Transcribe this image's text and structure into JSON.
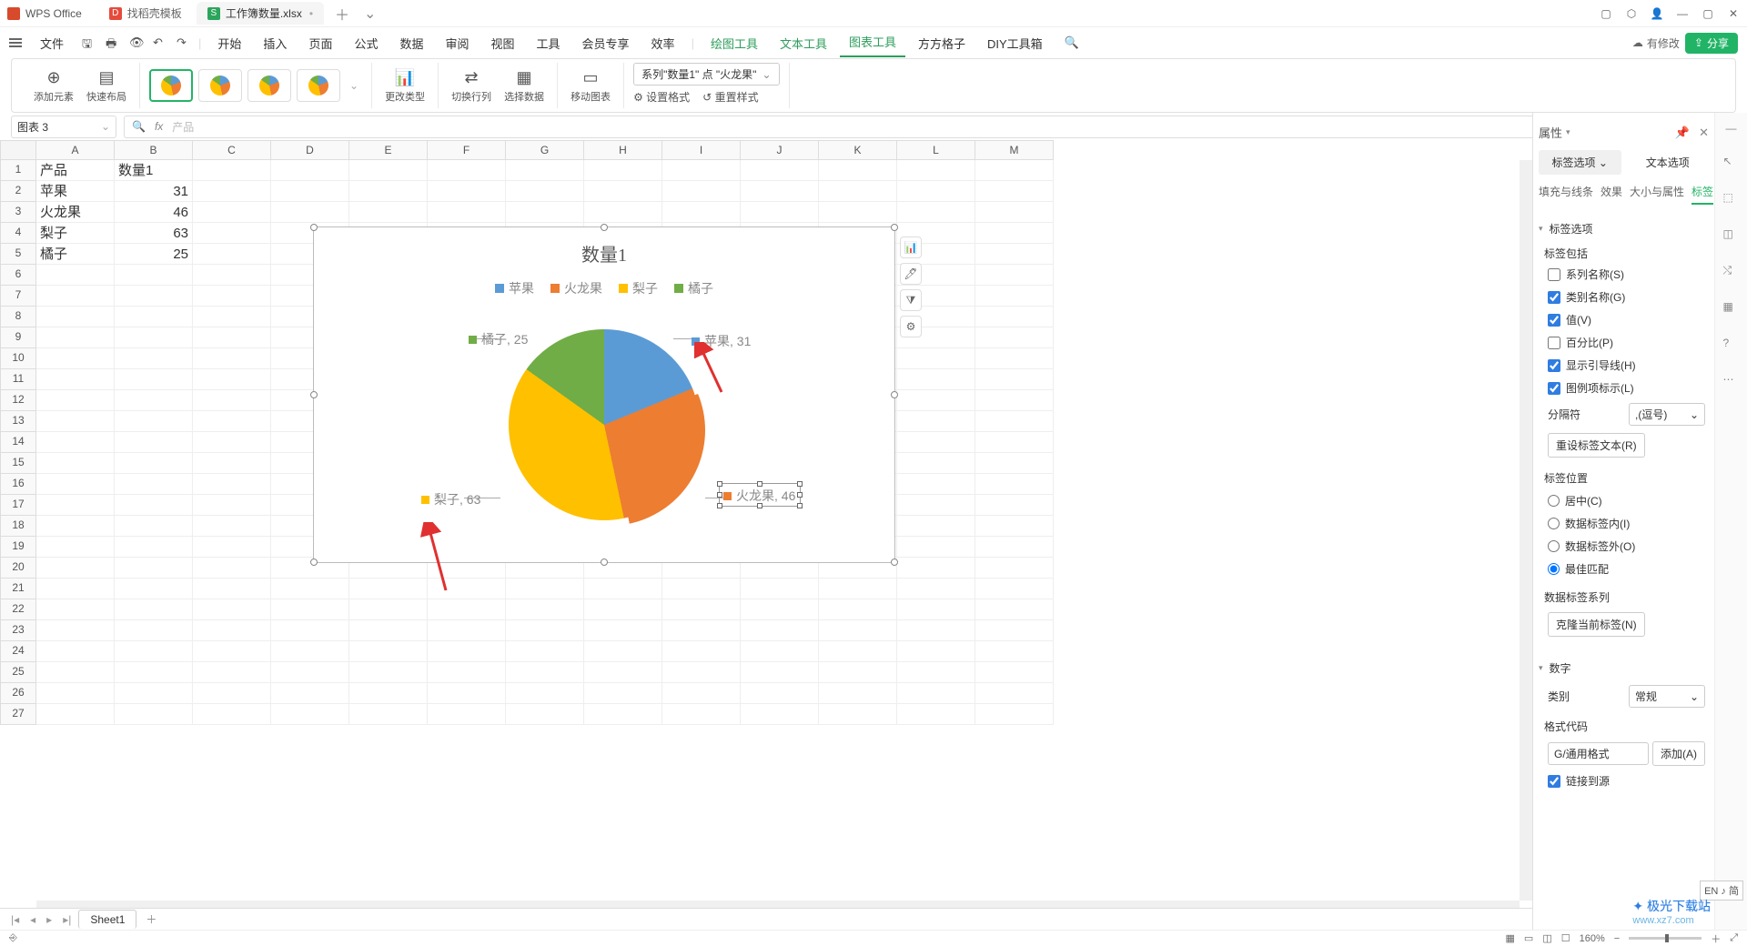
{
  "app": {
    "name": "WPS Office"
  },
  "tabs": [
    {
      "label": "找稻壳模板"
    },
    {
      "label": "工作簿数量.xlsx"
    }
  ],
  "menus": {
    "file": "文件",
    "list": [
      "开始",
      "插入",
      "页面",
      "公式",
      "数据",
      "审阅",
      "视图",
      "工具",
      "会员专享",
      "效率"
    ],
    "list2": [
      "绘图工具",
      "文本工具",
      "图表工具",
      "方方格子",
      "DIY工具箱"
    ],
    "cloud": "有修改",
    "share": "分享"
  },
  "ribbon": {
    "add_elem": "添加元素",
    "quick_layout": "快速布局",
    "change_type": "更改类型",
    "swap_rc": "切换行列",
    "select_data": "选择数据",
    "move_chart": "移动图表",
    "series_sel": "系列\"数量1\" 点 \"火龙果\"",
    "set_format": "设置格式",
    "reset_style": "重置样式"
  },
  "namebox": "图表 3",
  "formula_hint": "产品",
  "columns": [
    "A",
    "B",
    "C",
    "D",
    "E",
    "F",
    "G",
    "H",
    "I",
    "J",
    "K",
    "L",
    "M"
  ],
  "rows_count": 27,
  "cells": {
    "A1": "产品",
    "B1": "数量1",
    "A2": "苹果",
    "B2": "31",
    "A3": "火龙果",
    "B3": "46",
    "A4": "梨子",
    "B4": "63",
    "A5": "橘子",
    "B5": "25"
  },
  "chart_data": {
    "type": "pie",
    "title": "数量1",
    "categories": [
      "苹果",
      "火龙果",
      "梨子",
      "橘子"
    ],
    "values": [
      31,
      46,
      63,
      25
    ],
    "colors": [
      "#5b9bd5",
      "#ed7d31",
      "#ffc000",
      "#70ad47"
    ],
    "labels": [
      "苹果, 31",
      "火龙果, 46",
      "梨子, 63",
      "橘子, 25"
    ]
  },
  "panel": {
    "title": "属性",
    "tab1": "标签选项",
    "tab2": "文本选项",
    "sub": [
      "填充与线条",
      "效果",
      "大小与属性",
      "标签"
    ],
    "sec_label_opts": "标签选项",
    "label_contains": "标签包括",
    "cb_series": "系列名称(S)",
    "cb_category": "类别名称(G)",
    "cb_value": "值(V)",
    "cb_percent": "百分比(P)",
    "cb_leader": "显示引导线(H)",
    "cb_legkey": "图例项标示(L)",
    "separator": "分隔符",
    "separator_val": ",(逗号)",
    "reset_text": "重设标签文本(R)",
    "label_pos": "标签位置",
    "pos_center": "居中(C)",
    "pos_inside": "数据标签内(I)",
    "pos_outside": "数据标签外(O)",
    "pos_best": "最佳匹配",
    "series_lbl": "数据标签系列",
    "clone_btn": "克隆当前标签(N)",
    "sec_num": "数字",
    "category": "类别",
    "cat_val": "常规",
    "format_code": "格式代码",
    "format_val": "G/通用格式",
    "add_btn": "添加(A)",
    "link_src": "链接到源"
  },
  "sheet_tabs": {
    "name": "Sheet1"
  },
  "status": {
    "zoom": "160%"
  },
  "ime": "EN ♪ 简",
  "watermark": {
    "name": "极光下载站",
    "url": "www.xz7.com"
  }
}
